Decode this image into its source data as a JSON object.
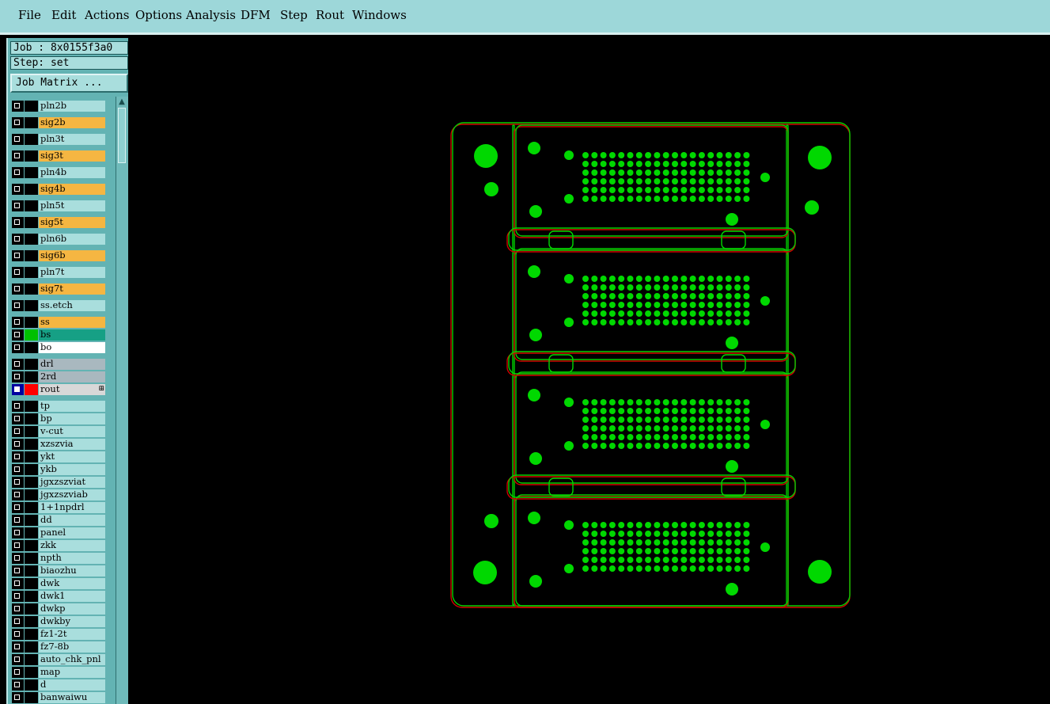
{
  "menu": [
    "File",
    "Edit",
    "Actions",
    "Options",
    "Analysis",
    "DFM",
    "Step",
    "Rout",
    "Windows"
  ],
  "job": {
    "label": "Job : 8x0155f3a0",
    "step": "Step: set",
    "matrix_button": "Job Matrix ..."
  },
  "colors": {
    "menubar": "#9dd7d9",
    "layer_default": "#a9dedd",
    "layer_signal": "#f5b642",
    "layer_bs": "#16a085",
    "layer_bo": "#ffffff",
    "layer_drill": "#a9b8bf",
    "layer_rout": "#d8d8d8",
    "rout_swatch": "#ff0000",
    "bs_swatch": "#00c000",
    "profile_green": "#00d000",
    "profile_red": "#d00000",
    "pad_green": "#00d800"
  },
  "layers": [
    {
      "name": "pln2b",
      "color": "#a9dedd"
    },
    {
      "name": "sig2b",
      "color": "#f5b642"
    },
    {
      "name": "pln3t",
      "color": "#a9dedd"
    },
    {
      "name": "sig3t",
      "color": "#f5b642"
    },
    {
      "name": "pln4b",
      "color": "#a9dedd"
    },
    {
      "name": "sig4b",
      "color": "#f5b642"
    },
    {
      "name": "pln5t",
      "color": "#a9dedd"
    },
    {
      "name": "sig5t",
      "color": "#f5b642"
    },
    {
      "name": "pln6b",
      "color": "#a9dedd"
    },
    {
      "name": "sig6b",
      "color": "#f5b642"
    },
    {
      "name": "pln7t",
      "color": "#a9dedd"
    },
    {
      "name": "sig7t",
      "color": "#f5b642"
    },
    {
      "name": "ss.etch",
      "color": "#a9dedd"
    },
    {
      "name": "ss",
      "color": "#f5b642"
    },
    {
      "name": "bs",
      "color": "#16a085",
      "swatch": "#00c000"
    },
    {
      "name": "bo",
      "color": "#ffffff"
    },
    {
      "name": "drl",
      "color": "#a9b8bf"
    },
    {
      "name": "2rd",
      "color": "#a9b8bf"
    },
    {
      "name": "rout",
      "color": "#d8d8d8",
      "swatch": "#ff0000",
      "selected": true,
      "marker": "⊞"
    },
    {
      "name": "tp",
      "color": "#a9dedd"
    },
    {
      "name": "bp",
      "color": "#a9dedd"
    },
    {
      "name": "v-cut",
      "color": "#a9dedd"
    },
    {
      "name": "xzszvia",
      "color": "#a9dedd"
    },
    {
      "name": "ykt",
      "color": "#a9dedd"
    },
    {
      "name": "ykb",
      "color": "#a9dedd"
    },
    {
      "name": "jgxzszviat",
      "color": "#a9dedd"
    },
    {
      "name": "jgxzszviab",
      "color": "#a9dedd"
    },
    {
      "name": "1+1npdrl",
      "color": "#a9dedd"
    },
    {
      "name": "dd",
      "color": "#a9dedd"
    },
    {
      "name": "panel",
      "color": "#a9dedd"
    },
    {
      "name": "zkk",
      "color": "#a9dedd"
    },
    {
      "name": "npth",
      "color": "#a9dedd"
    },
    {
      "name": "biaozhu",
      "color": "#a9dedd"
    },
    {
      "name": "dwk",
      "color": "#a9dedd"
    },
    {
      "name": "dwk1",
      "color": "#a9dedd"
    },
    {
      "name": "dwkp",
      "color": "#a9dedd"
    },
    {
      "name": "dwkby",
      "color": "#a9dedd"
    },
    {
      "name": "fz1-2t",
      "color": "#a9dedd"
    },
    {
      "name": "fz7-8b",
      "color": "#a9dedd"
    },
    {
      "name": "auto_chk_pnl",
      "color": "#a9dedd"
    },
    {
      "name": "map",
      "color": "#a9dedd"
    },
    {
      "name": "d",
      "color": "#a9dedd"
    },
    {
      "name": "banwaiwu",
      "color": "#a9dedd"
    }
  ]
}
